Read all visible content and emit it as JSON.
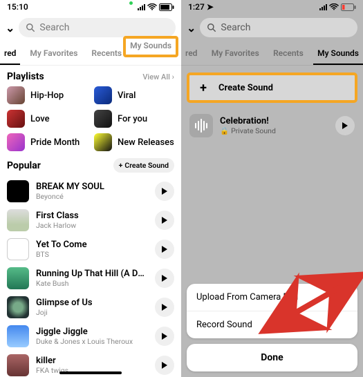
{
  "left": {
    "status_time": "15:10",
    "search_placeholder": "Search",
    "tabs": {
      "featured": "red",
      "fav": "My Favorites",
      "recents": "Recents",
      "mysounds": "My Sounds"
    },
    "playlists": {
      "header": "Playlists",
      "view_all": "View All",
      "items": [
        {
          "label": "Hip-Hop"
        },
        {
          "label": "Viral"
        },
        {
          "label": "Love"
        },
        {
          "label": "For you"
        },
        {
          "label": "Pride Month"
        },
        {
          "label": "New Releases"
        }
      ]
    },
    "popular": {
      "header": "Popular",
      "create": "Create Sound",
      "songs": [
        {
          "title": "BREAK MY SOUL",
          "artist": "Beyoncé"
        },
        {
          "title": "First Class",
          "artist": "Jack Harlow"
        },
        {
          "title": "Yet To Come",
          "artist": "BTS"
        },
        {
          "title": "Running Up That Hill (A Deal With God)",
          "artist": "Kate Bush"
        },
        {
          "title": "Glimpse of Us",
          "artist": "Joji"
        },
        {
          "title": "Jiggle Jiggle",
          "artist": "Duke & Jones x Louis Theroux"
        },
        {
          "title": "killer",
          "artist": "FKA twigs"
        }
      ]
    }
  },
  "right": {
    "status_time": "1:27",
    "search_placeholder": "Search",
    "tabs": {
      "featured": "red",
      "fav": "My Favorites",
      "recents": "Recents",
      "mysounds": "My Sounds"
    },
    "create_label": "Create Sound",
    "sound": {
      "title": "Celebration!",
      "subtitle": "Private Sound"
    },
    "sheet": {
      "upload": "Upload From Camera Roll",
      "record": "Record Sound",
      "done": "Done"
    }
  }
}
